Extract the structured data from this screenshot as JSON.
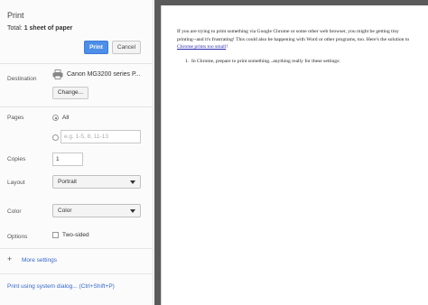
{
  "sidebar": {
    "title": "Print",
    "total_prefix": "Total: ",
    "total_value": "1 sheet of paper",
    "print_button": "Print",
    "cancel_button": "Cancel",
    "destination": {
      "label": "Destination",
      "printer_name": "Canon MG3200 series P...",
      "change_button": "Change..."
    },
    "pages": {
      "label": "Pages",
      "all_label": "All",
      "custom_placeholder": "e.g. 1-5, 8, 11-13"
    },
    "copies": {
      "label": "Copies",
      "value": "1"
    },
    "layout": {
      "label": "Layout",
      "value": "Portrait"
    },
    "color": {
      "label": "Color",
      "value": "Color"
    },
    "options": {
      "label": "Options",
      "two_sided_label": "Two-sided"
    },
    "more_settings": "More settings",
    "system_dialog": "Print using system dialog... (Ctrl+Shift+P)",
    "accent_color": "#4d8ee8",
    "link_color": "#3366cc",
    "icons": [
      "printer-icon",
      "plus-icon",
      "chevron-down-icon"
    ]
  },
  "preview": {
    "paragraph_text": "If you are trying to print something via Google Chrome or some other web browser, you might be getting tiny printing--and it's frustrating! This could also be happening with Word or other programs, too. Here's the solution to ",
    "paragraph_link": "Chrome prints too small",
    "paragraph_end": "!",
    "list_item": "In Chrome, prepare to print something...anything really for these settings:"
  }
}
